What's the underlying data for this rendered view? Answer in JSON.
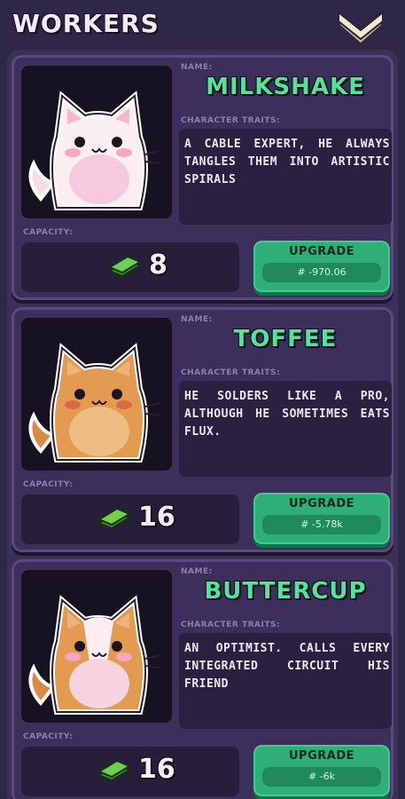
{
  "header": {
    "title": "WORKERS",
    "collapse_icon": "chevron-down-icon"
  },
  "labels": {
    "name": "NAME:",
    "traits": "CHARACTER TRAITS:",
    "capacity": "CAPACITY:",
    "upgrade": "UPGRADE"
  },
  "colors": {
    "name_accent": "#54e39a",
    "upgrade_button": "#2fae77",
    "background": "#2f2748"
  },
  "workers": [
    {
      "name": "MILKSHAKE",
      "traits": "A CABLE EXPERT, HE ALWAYS TANGLES THEM INTO ARTISTIC SPIRALS",
      "capacity": "8",
      "upgrade_price": "# -970.06",
      "portrait": "white-cat-icon"
    },
    {
      "name": "TOFFEE",
      "traits": "HE SOLDERS LIKE A PRO, ALTHOUGH HE SOMETIMES EATS FLUX.",
      "capacity": "16",
      "upgrade_price": "# -5.78k",
      "portrait": "orange-cat-icon"
    },
    {
      "name": "BUTTERCUP",
      "traits": "AN OPTIMIST. CALLS EVERY INTEGRATED CIRCUIT HIS FRIEND",
      "capacity": "16",
      "upgrade_price": "# -6k",
      "portrait": "calico-cat-icon"
    }
  ]
}
